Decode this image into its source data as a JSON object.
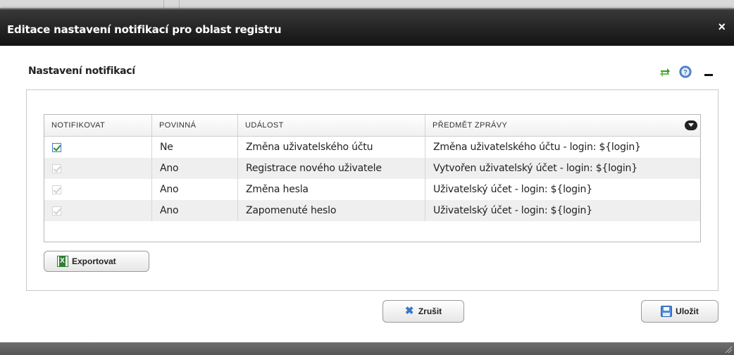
{
  "dialog": {
    "title": "Editace nastavení notifikací pro oblast registru",
    "close_label": "×"
  },
  "section": {
    "title": "Nastavení notifikací"
  },
  "icons": {
    "refresh": "refresh-icon",
    "help": "help-icon",
    "minimize": "minimize-icon",
    "column_options": "chevron-down-icon",
    "export": "excel-icon",
    "cancel": "close-icon",
    "save": "floppy-disk-icon"
  },
  "grid": {
    "columns": [
      "NOTIFIKOVAT",
      "POVINNÁ",
      "UDÁLOST",
      "PŘEDMĚT ZPRÁVY"
    ],
    "rows": [
      {
        "notify": true,
        "enabled": true,
        "required": "Ne",
        "event": "Změna uživatelského účtu",
        "subject": "Změna uživatelského účtu - login: ${login}"
      },
      {
        "notify": true,
        "enabled": false,
        "required": "Ano",
        "event": "Registrace nového uživatele",
        "subject": "Vytvořen uživatelský účet - login: ${login}"
      },
      {
        "notify": true,
        "enabled": false,
        "required": "Ano",
        "event": "Změna hesla",
        "subject": "Uživatelský účet - login: ${login}"
      },
      {
        "notify": true,
        "enabled": false,
        "required": "Ano",
        "event": "Zapomenuté heslo",
        "subject": "Uživatelský účet - login: ${login}"
      }
    ]
  },
  "buttons": {
    "export": "Exportovat",
    "cancel": "Zrušit",
    "save": "Uložit"
  },
  "colors": {
    "titlebar": "#1d1d1d",
    "row_alt": "#efefef",
    "check": "#2e8b20",
    "accent": "#3a7bd5"
  }
}
